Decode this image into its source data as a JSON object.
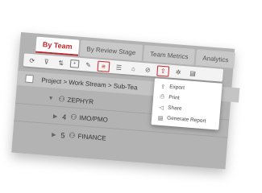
{
  "tabs": [
    {
      "label": "By Team",
      "active": true
    },
    {
      "label": "By Review Stage",
      "active": false
    },
    {
      "label": "Team Metrics",
      "active": false
    },
    {
      "label": "Analytics",
      "active": false
    }
  ],
  "toolbar": {
    "icons": [
      "refresh-icon",
      "filter-icon",
      "sort-icon",
      "expand-icon",
      "edit-icon",
      "list-view-icon",
      "columns-icon",
      "lock-icon",
      "attachment-icon",
      "share-icon",
      "settings-icon",
      "clipboard-icon"
    ],
    "accent": "#c0272d"
  },
  "breadcrumb": "Project > Work Stream > Sub-Tea",
  "rows": [
    {
      "index": "",
      "label": "ZEPHYR"
    },
    {
      "index": "4",
      "label": "IMO/PMO"
    },
    {
      "index": "5",
      "label": "FINANCE"
    }
  ],
  "menu": {
    "items": [
      {
        "label": "Export",
        "icon": "export-icon"
      },
      {
        "label": "Print",
        "icon": "print-icon"
      },
      {
        "label": "Share",
        "icon": "share-icon"
      },
      {
        "label": "Generate Report",
        "icon": "report-icon"
      }
    ]
  }
}
